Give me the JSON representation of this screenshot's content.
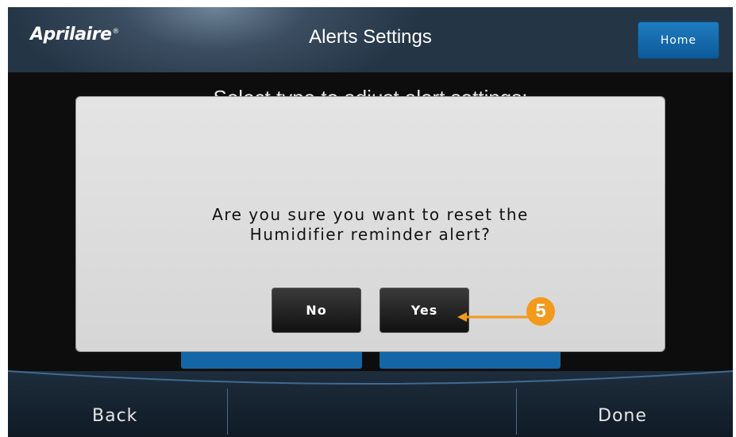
{
  "header": {
    "logo": "Aprilaire",
    "logo_mark": "®",
    "title": "Alerts Settings",
    "home_label": "Home"
  },
  "content": {
    "instruction": "Select type to adjust alert settings:"
  },
  "modal": {
    "message_line1": "Are you sure you want to reset the",
    "message_line2": "Humidifier reminder alert?",
    "no_label": "No",
    "yes_label": "Yes"
  },
  "footer": {
    "back_label": "Back",
    "done_label": "Done"
  },
  "callout": {
    "step_number": "5",
    "color": "#f29a1c"
  },
  "colors": {
    "accent_blue": "#1566a6",
    "header_bg": "#2e4254",
    "modal_bg": "#dcdcdc"
  }
}
